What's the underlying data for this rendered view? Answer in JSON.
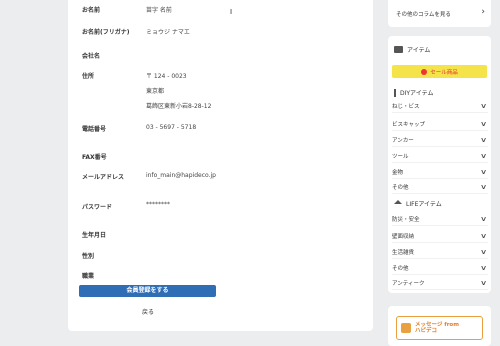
{
  "form": {
    "fields": [
      {
        "label": "お名前",
        "value": "苗字 名前"
      },
      {
        "label": "お名前(フリガナ)",
        "value": "ミョウジ ナマエ"
      },
      {
        "label": "会社名",
        "value": ""
      },
      {
        "label": "住所",
        "value": "〒 124 - 0023"
      },
      {
        "label": "電話番号",
        "value": "03 - 5697 - 5718"
      },
      {
        "label": "FAX番号",
        "value": ""
      },
      {
        "label": "メールアドレス",
        "value": "info_main@hapideco.jp"
      },
      {
        "label": "パスワード",
        "value": "********"
      },
      {
        "label": "生年月日",
        "value": ""
      },
      {
        "label": "性別",
        "value": ""
      },
      {
        "label": "職業",
        "value": ""
      }
    ],
    "address_line2": "東京都",
    "address_line3": "葛飾区東新小岩8-28-12",
    "submit_label": "会員登録をする",
    "back_label": "戻る"
  },
  "sidebar": {
    "other_columns": "その他のコラムを見る",
    "items_heading": "アイテム",
    "sale_label": "セール商品",
    "diy_heading": "DIYアイテム",
    "diy_items": [
      "ねじ・ビス",
      "ビスキャップ",
      "アンカー",
      "ツール",
      "金物",
      "その他"
    ],
    "life_heading": "LIFEアイテム",
    "life_items": [
      "防災・安全",
      "壁面収納",
      "生活雑貨",
      "その他",
      "アンティーク"
    ],
    "message_line1": "メッセージ from",
    "message_line2": "ハピデコ"
  }
}
